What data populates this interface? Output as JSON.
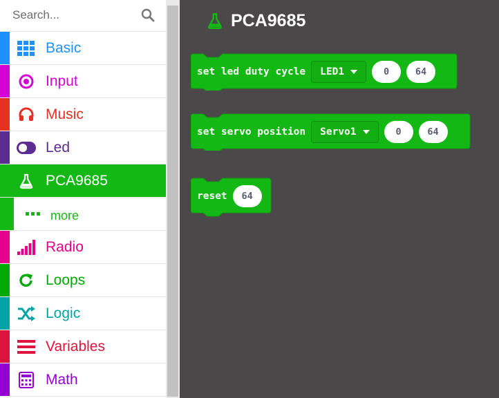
{
  "search": {
    "placeholder": "Search..."
  },
  "categories": [
    {
      "label": "Basic",
      "color": "#1e90ff",
      "icon": "grid-icon"
    },
    {
      "label": "Input",
      "color": "#d400d4",
      "icon": "target-icon"
    },
    {
      "label": "Music",
      "color": "#e63022",
      "icon": "headphones-icon"
    },
    {
      "label": "Led",
      "color": "#5c2d91",
      "icon": "toggle-icon"
    },
    {
      "label": "PCA9685",
      "color": "#14b814",
      "icon": "flask-icon"
    },
    {
      "label": "more",
      "color": "#14b814",
      "icon": "dots-icon"
    },
    {
      "label": "Radio",
      "color": "#e3008c",
      "icon": "signal-bars-icon"
    },
    {
      "label": "Loops",
      "color": "#00aa00",
      "icon": "refresh-icon"
    },
    {
      "label": "Logic",
      "color": "#00a4a6",
      "icon": "shuffle-icon"
    },
    {
      "label": "Variables",
      "color": "#dc143c",
      "icon": "list-lines-icon"
    },
    {
      "label": "Math",
      "color": "#9400d3",
      "icon": "calculator-icon"
    }
  ],
  "workspace": {
    "title": "PCA9685",
    "blocks": {
      "led": {
        "text": "set led duty cycle",
        "dropdown": "LED1",
        "value1": "0",
        "value2": "64"
      },
      "servo": {
        "text": "set servo position",
        "dropdown": "Servo1",
        "value1": "0",
        "value2": "64"
      },
      "reset": {
        "text": "reset",
        "value1": "64"
      }
    }
  },
  "colors": {
    "block_fill": "#14b814",
    "block_stroke": "#0f9a0f",
    "workspace_bg": "#4a4848"
  }
}
